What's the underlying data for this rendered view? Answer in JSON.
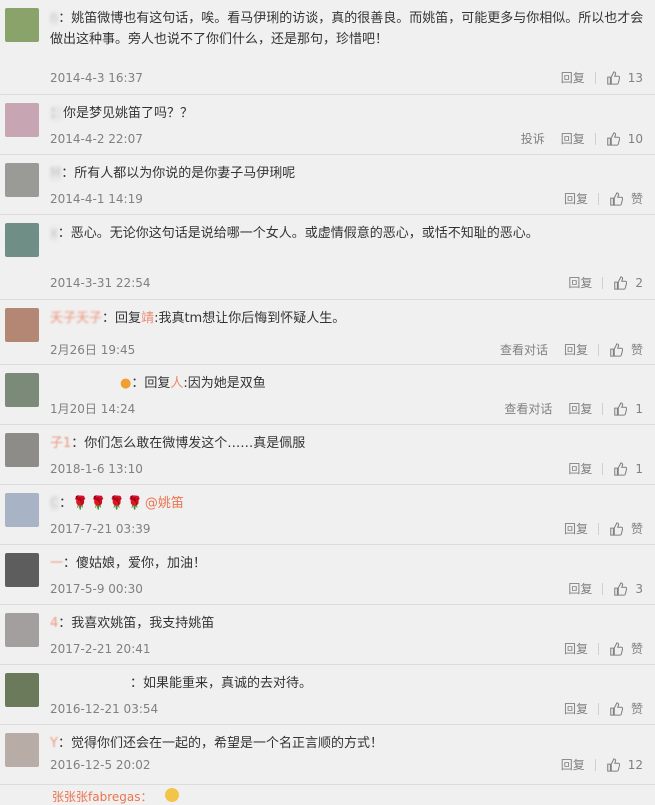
{
  "labels": {
    "reply": "回复",
    "report": "投诉",
    "view_thread": "查看对话",
    "like_zero": "赞"
  },
  "comments": [
    {
      "user": "n",
      "colon": "：",
      "text": "姚笛微博也有这句话，唉。看马伊琍的访谈，真的很善良。而姚笛，可能更多与你相似。所以也才会做出这种事。旁人也说不了你们什么，还是那句，珍惜吧！",
      "time": "2014-4-3 16:37",
      "likes": "13",
      "report": false,
      "view": false
    },
    {
      "user": "：",
      "colon": "",
      "text": "你是梦见姚笛了吗？？",
      "time": "2014-4-2 22:07",
      "likes": "10",
      "report": true,
      "view": false
    },
    {
      "user": "M",
      "colon": "：",
      "text": "所有人都以为你说的是你妻子马伊琍呢",
      "time": "2014-4-1 14:19",
      "likes": "赞",
      "report": false,
      "view": false
    },
    {
      "user": "x",
      "colon": "：",
      "text": "恶心。无论你这句话是说给哪一个女人。或虚情假意的恶心，或恬不知耻的恶心。",
      "time": "2014-3-31 22:54",
      "likes": "2",
      "report": false,
      "view": false
    },
    {
      "user": "夭子夭子",
      "colon": "：",
      "reply_prefix": "回复",
      "reply_to": "靖",
      "text": "我真tm想让你后悔到怀疑人生。",
      "time": "2月26日 19:45",
      "likes": "赞",
      "report": false,
      "view": true
    },
    {
      "user": "",
      "colon": "：",
      "reply_prefix": "回复",
      "reply_to": "人",
      "text": "因为她是双鱼",
      "time": "1月20日 14:24",
      "likes": "1",
      "report": false,
      "view": true
    },
    {
      "user": "子1",
      "colon": "：",
      "text": "你们怎么敢在微博发这个……真是佩服",
      "time": "2018-1-6 13:10",
      "likes": "1",
      "report": false,
      "view": false
    },
    {
      "user": "C",
      "colon": "：",
      "text": "🌹🌹🌹🌹",
      "mention": "@姚笛",
      "time": "2017-7-21 03:39",
      "likes": "赞",
      "report": false,
      "view": false
    },
    {
      "user": "一",
      "colon": "：",
      "text": "傻姑娘，爱你，加油！",
      "time": "2017-5-9 00:30",
      "likes": "3",
      "report": false,
      "view": false
    },
    {
      "user": "4",
      "colon": "：",
      "text": "我喜欢姚笛，我支持姚笛",
      "time": "2017-2-21 20:41",
      "likes": "赞",
      "report": false,
      "view": false
    },
    {
      "user": "",
      "colon": "：",
      "text": "如果能重来，真诚的去对待。",
      "time": "2016-12-21 03:54",
      "likes": "赞",
      "report": false,
      "view": false
    },
    {
      "user": "Y",
      "colon": "：",
      "text": "觉得你们还会在一起的，希望是一个名正言顺的方式！",
      "time": "2016-12-5 20:02",
      "likes": "12",
      "report": false,
      "view": false
    }
  ],
  "last_user": "张张张fabregas："
}
